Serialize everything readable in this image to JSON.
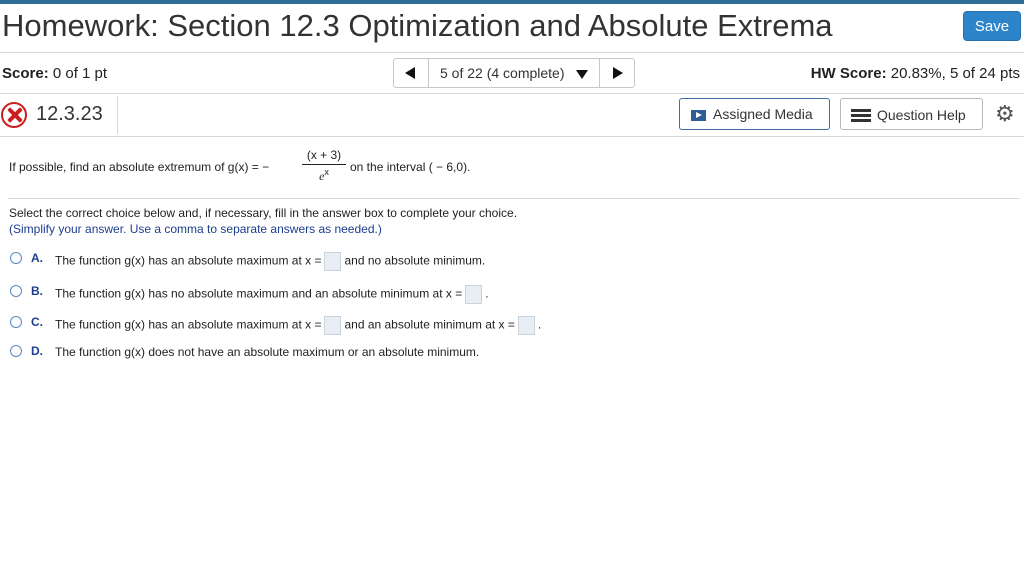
{
  "header": {
    "title": "Homework: Section 12.3 Optimization and Absolute Extrema",
    "save_label": "Save"
  },
  "score_bar": {
    "score_label": "Score:",
    "score_value": "0 of 1 pt",
    "nav_position": "5 of 22 (4 complete)",
    "hw_score_label": "HW Score:",
    "hw_score_value": "20.83%, 5 of 24 pts"
  },
  "question_bar": {
    "number": "12.3.23",
    "status": "incorrect",
    "status_color": "#cc1f1f",
    "assigned_media_label": "Assigned Media",
    "question_help_label": "Question Help",
    "icons": [
      "x-circle-icon",
      "chevron-left-icon",
      "chevron-right-icon",
      "chevron-down-icon",
      "media-play-icon",
      "list-icon",
      "gear-icon"
    ]
  },
  "question": {
    "prompt": "If possible, find an absolute extremum of g(x) = −",
    "fraction_numerator": "(x + 3)",
    "fraction_denominator_base": "e",
    "fraction_denominator_exp": "x",
    "interval_text": "on the interval ( − 6,0).",
    "instruction": "Select the correct choice below and, if necessary, fill in the answer box to complete your choice.",
    "note": "(Simplify your answer. Use a comma to separate answers as needed.)",
    "choices": [
      {
        "letter": "A.",
        "text_1": "The function g(x) has an absolute maximum at x =",
        "text_2": "and no absolute minimum."
      },
      {
        "letter": "B.",
        "text_1": "The function g(x) has no absolute maximum and an absolute minimum at x =",
        "text_2": "."
      },
      {
        "letter": "C.",
        "text_1": "The function g(x) has an absolute maximum at x =",
        "text_2": "and an absolute minimum at x =",
        "text_3": "."
      },
      {
        "letter": "D.",
        "text_1": "The function g(x) does not have an absolute maximum or an absolute minimum."
      }
    ]
  },
  "colors": {
    "accent_blue": "#2d84c9",
    "top_bar": "#2e6f99",
    "choice_letter": "#1d3d8f"
  }
}
